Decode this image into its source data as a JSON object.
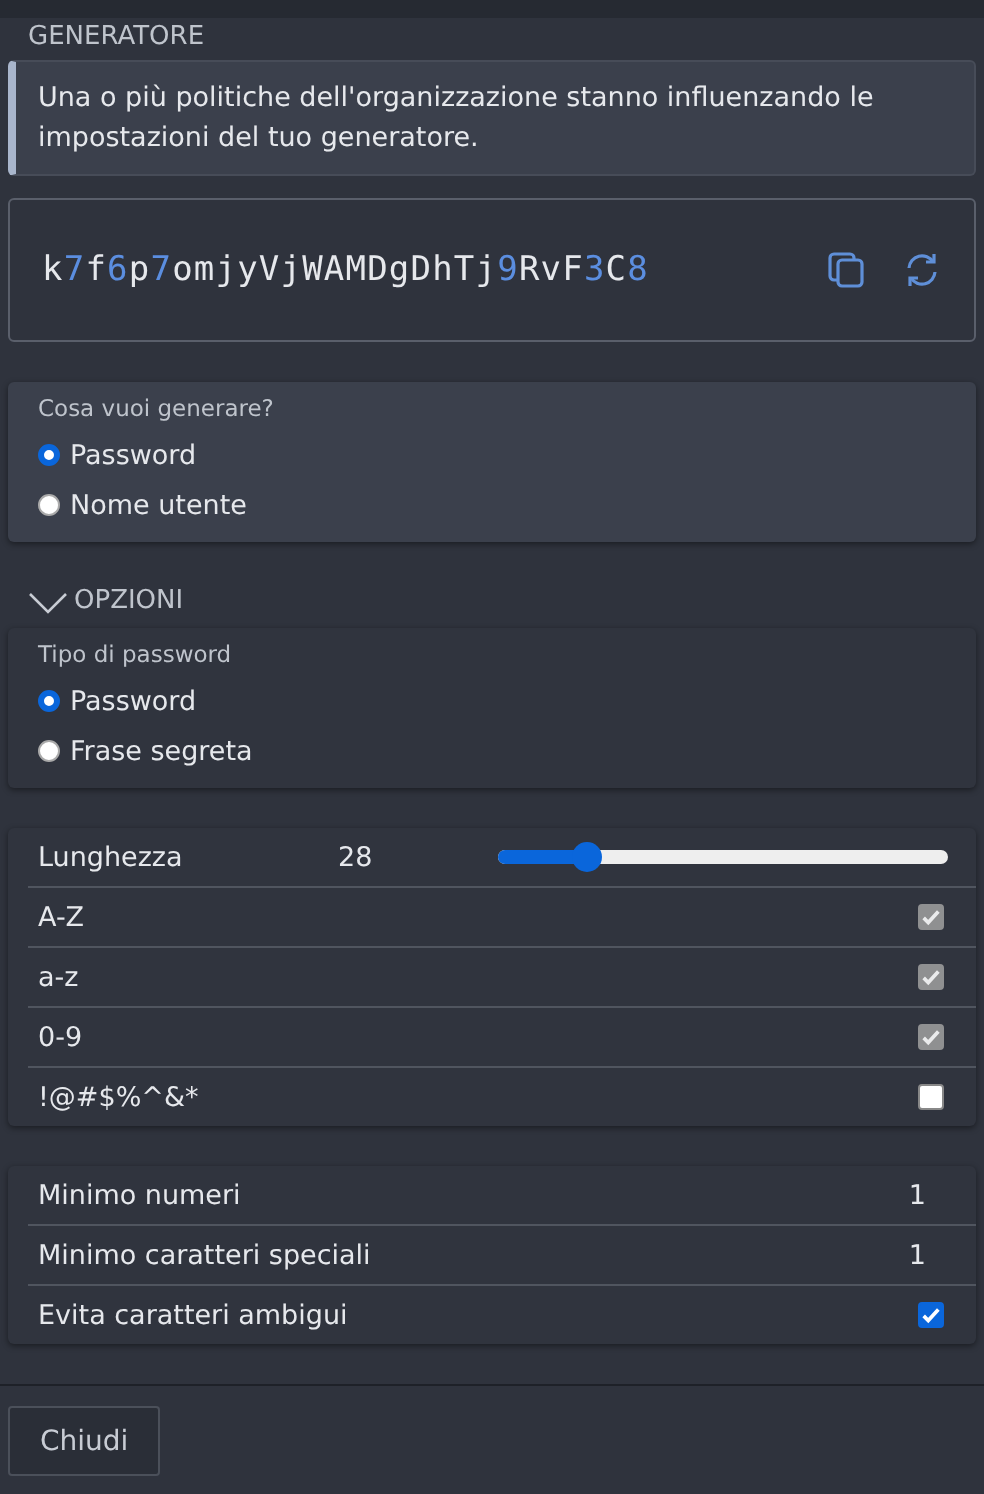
{
  "section_title": "GENERATORE",
  "policy_notice": "Una o più politiche dell'organizzazione stanno influenzando le impostazioni del tuo generatore.",
  "generated_password": [
    {
      "text": "k",
      "kind": "letter"
    },
    {
      "text": "7",
      "kind": "digit"
    },
    {
      "text": "f",
      "kind": "letter"
    },
    {
      "text": "6",
      "kind": "digit"
    },
    {
      "text": "p",
      "kind": "letter"
    },
    {
      "text": "7",
      "kind": "digit"
    },
    {
      "text": "omjyVjWAMDgDhTj",
      "kind": "letter"
    },
    {
      "text": "9",
      "kind": "digit"
    },
    {
      "text": "RvF",
      "kind": "letter"
    },
    {
      "text": "3",
      "kind": "digit"
    },
    {
      "text": "C",
      "kind": "letter"
    },
    {
      "text": "8",
      "kind": "digit"
    }
  ],
  "generate_type": {
    "label": "Cosa vuoi generare?",
    "options": [
      {
        "label": "Password",
        "selected": true
      },
      {
        "label": "Nome utente",
        "selected": false
      }
    ]
  },
  "options_header": {
    "label": "OPZIONI",
    "expanded": true
  },
  "password_type": {
    "label": "Tipo di password",
    "options": [
      {
        "label": "Password",
        "selected": true
      },
      {
        "label": "Frase segreta",
        "selected": false
      }
    ]
  },
  "length": {
    "label": "Lunghezza",
    "value": "28",
    "level": 0.2
  },
  "charsets": [
    {
      "label": "A-Z",
      "checked": true,
      "disabled": true
    },
    {
      "label": "a-z",
      "checked": true,
      "disabled": true
    },
    {
      "label": "0-9",
      "checked": true,
      "disabled": true
    },
    {
      "label": "!@#$%^&*",
      "checked": false,
      "disabled": false
    }
  ],
  "extras": [
    {
      "kind": "number",
      "label": "Minimo numeri",
      "value": "1"
    },
    {
      "kind": "number",
      "label": "Minimo caratteri speciali",
      "value": "1"
    },
    {
      "kind": "checkbox",
      "label": "Evita caratteri ambigui",
      "checked": true,
      "disabled": false
    }
  ],
  "close_button": "Chiudi"
}
